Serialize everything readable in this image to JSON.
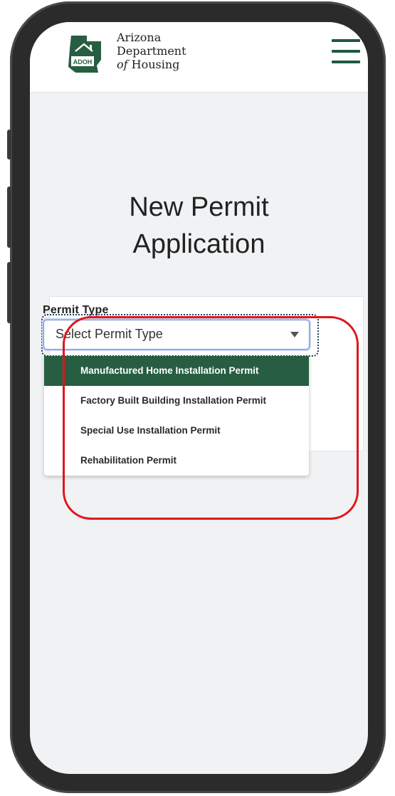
{
  "header": {
    "logo": {
      "abbr": "ADOH",
      "line1": "Arizona",
      "line2": "Department",
      "line3_prefix": "of",
      "line3_rest": " Housing"
    },
    "menu_icon": "hamburger-icon"
  },
  "page": {
    "title_line1": "New Permit",
    "title_line2": "Application"
  },
  "form": {
    "permit_type_label": "Permit Type",
    "select_value": "Select Permit Type",
    "options": [
      "Manufactured Home Installation Permit",
      "Factory Built Building Installation Permit",
      "Special Use Installation Permit",
      "Rehabilitation Permit"
    ],
    "highlighted_option_index": 0
  },
  "colors": {
    "brand_green": "#275e41",
    "annotation_red": "#e0161b",
    "background": "#f0f2f4"
  }
}
